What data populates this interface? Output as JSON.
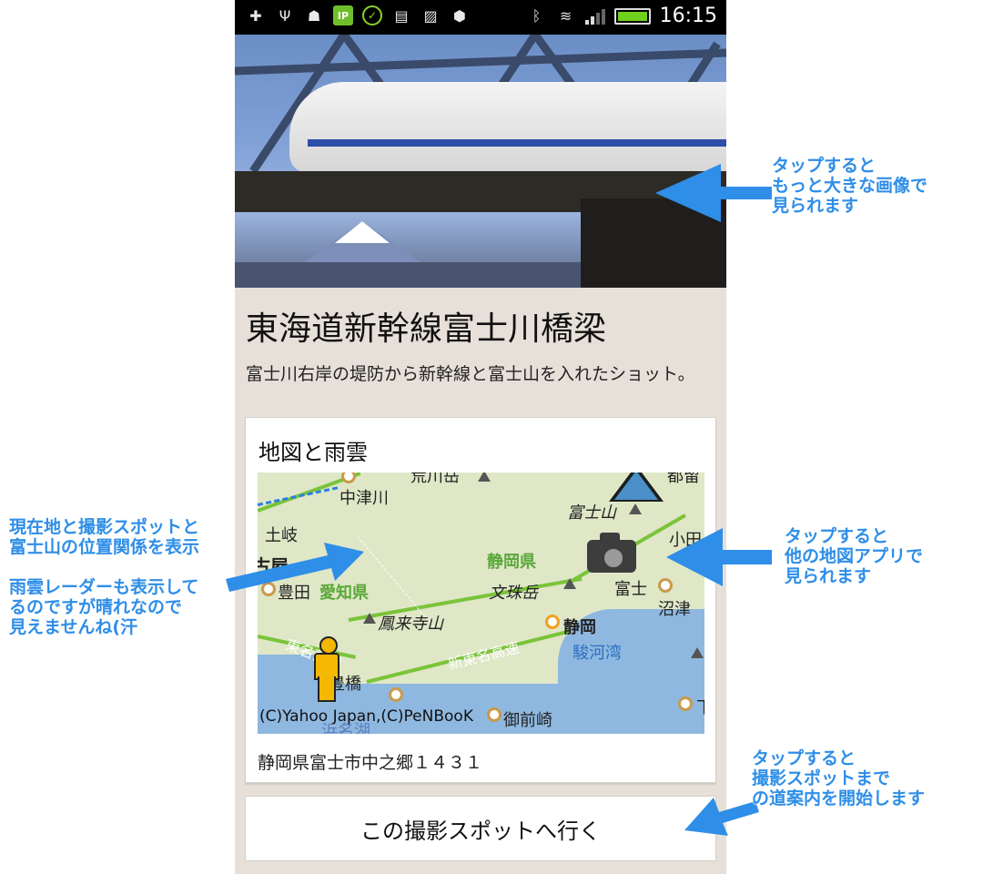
{
  "status_bar": {
    "time": "16:15",
    "icons": [
      "notification-icon",
      "usb-icon",
      "android-debug-icon",
      "ip-app-icon",
      "check-icon",
      "clipboard-icon",
      "gallery-icon",
      "nfc-icon",
      "bluetooth-icon",
      "wifi-icon",
      "signal-icon",
      "battery-icon"
    ],
    "ip_badge": "IP"
  },
  "spot": {
    "title": "東海道新幹線富士川橋梁",
    "description": "富士川右岸の堤防から新幹線と富士山を入れたショット。"
  },
  "map_card": {
    "heading": "地図と雨雲",
    "map_labels": {
      "nakatsugawa": "中津川",
      "toki": "土岐",
      "nagoya": "古屋",
      "toyota": "豊田",
      "aichi": "愛知県",
      "horaiji": "鳳来寺山",
      "shizuoka_pref": "静岡県",
      "bunju": "文珠岳",
      "fujisan": "富士山",
      "fuji": "富士",
      "numazu": "沼津",
      "shizuoka": "静岡",
      "suruga": "駿河湾",
      "toyohashi": "豊橋",
      "shin_tomei": "新東名高速",
      "tomei": "東名高速",
      "odawara": "小田",
      "tsuru": "都留",
      "mount_top": "荒川岳",
      "omaezaki": "御前崎",
      "hamana": "浜名湖",
      "shimoda": "下"
    },
    "copyright": "(C)Yahoo Japan,(C)PeNBooK",
    "address": "静岡県富士市中之郷１４３１"
  },
  "action": {
    "go_label": "この撮影スポットへ行く"
  },
  "callouts": {
    "photo": [
      "タップすると",
      "もっと大きな画像で",
      "見られます"
    ],
    "map_left_1": [
      "現在地と撮影スポットと",
      "富士山の位置関係を表示"
    ],
    "map_left_2": [
      "雨雲レーダーも表示して",
      "るのですが晴れなので",
      "見えませんね(汗"
    ],
    "map_right": [
      "タップすると",
      "他の地図アプリで",
      "見られます"
    ],
    "go": [
      "タップすると",
      "撮影スポットまで",
      "の道案内を開始します"
    ]
  },
  "colors": {
    "callout": "#2e8ee8",
    "background": "#e6e0d8",
    "road": "#7ac43a",
    "sea": "#8fb8e0"
  }
}
